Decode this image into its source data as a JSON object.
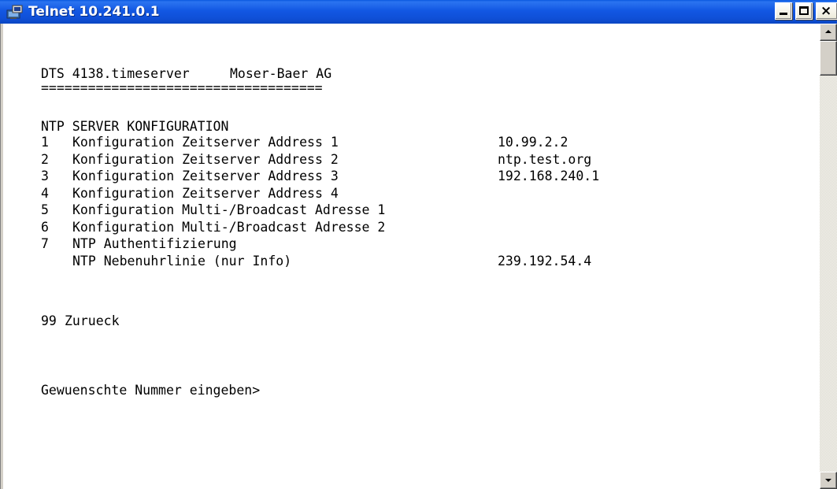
{
  "window": {
    "title": "Telnet 10.241.0.1",
    "icon": "telnet-terminal-icon",
    "controls": {
      "minimize": "minimize-icon",
      "maximize": "maximize-icon",
      "close": "close-icon",
      "close_glyph": "×"
    }
  },
  "terminal": {
    "header": {
      "product": "DTS 4138.timeserver",
      "vendor": "Moser-Baer AG",
      "separator": "===================================="
    },
    "section_title": "NTP SERVER KONFIGURATION",
    "menu": [
      {
        "num": "1",
        "label": "Konfiguration Zeitserver Address 1",
        "value": "10.99.2.2"
      },
      {
        "num": "2",
        "label": "Konfiguration Zeitserver Address 2",
        "value": "ntp.test.org"
      },
      {
        "num": "3",
        "label": "Konfiguration Zeitserver Address 3",
        "value": "192.168.240.1"
      },
      {
        "num": "4",
        "label": "Konfiguration Zeitserver Address 4",
        "value": ""
      },
      {
        "num": "5",
        "label": "Konfiguration Multi-/Broadcast Adresse 1",
        "value": ""
      },
      {
        "num": "6",
        "label": "Konfiguration Multi-/Broadcast Adresse 2",
        "value": ""
      },
      {
        "num": "7",
        "label": "NTP Authentifizierung",
        "value": ""
      },
      {
        "num": "",
        "label": "NTP Nebenuhrlinie (nur Info)",
        "value": "239.192.54.4"
      }
    ],
    "back_option": {
      "num": "99",
      "label": "Zurueck"
    },
    "prompt": "Gewuenschte Nummer eingeben>"
  },
  "colors": {
    "titlebar": "#0f4fd6",
    "terminal_bg": "#ffffff",
    "terminal_fg": "#000000"
  }
}
